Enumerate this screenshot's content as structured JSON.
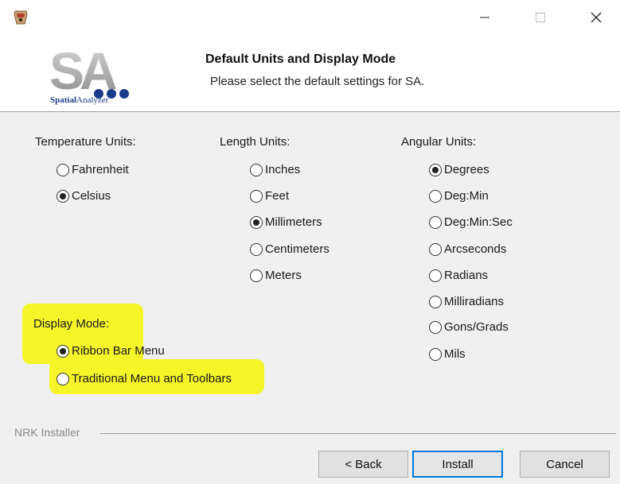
{
  "window": {
    "title": "",
    "controls": {
      "minimize": "—",
      "maximize": "□",
      "close": "✕"
    }
  },
  "header": {
    "logo_text": "SA",
    "logo_sub_bold": "Spatial",
    "logo_sub_rest": "Analyzer",
    "title": "Default Units and Display Mode",
    "subtitle": "Please select the default settings for SA."
  },
  "temperature": {
    "label": "Temperature Units:",
    "options": [
      {
        "label": "Fahrenheit",
        "checked": false
      },
      {
        "label": "Celsius",
        "checked": true
      }
    ]
  },
  "length": {
    "label": "Length Units:",
    "options": [
      {
        "label": "Inches",
        "checked": false
      },
      {
        "label": "Feet",
        "checked": false
      },
      {
        "label": "Millimeters",
        "checked": true
      },
      {
        "label": "Centimeters",
        "checked": false
      },
      {
        "label": "Meters",
        "checked": false
      }
    ]
  },
  "angular": {
    "label": "Angular Units:",
    "options": [
      {
        "label": "Degrees",
        "checked": true
      },
      {
        "label": "Deg:Min",
        "checked": false
      },
      {
        "label": "Deg:Min:Sec",
        "checked": false
      },
      {
        "label": "Arcseconds",
        "checked": false
      },
      {
        "label": "Radians",
        "checked": false
      },
      {
        "label": "Milliradians",
        "checked": false
      },
      {
        "label": "Gons/Grads",
        "checked": false
      },
      {
        "label": "Mils",
        "checked": false
      }
    ]
  },
  "display_mode": {
    "label": "Display Mode:",
    "options": [
      {
        "label": "Ribbon Bar Menu",
        "checked": true
      },
      {
        "label": "Traditional Menu and Toolbars",
        "checked": false
      }
    ]
  },
  "footer": {
    "installer_label": "NRK Installer",
    "back_label": "< Back",
    "install_label": "Install",
    "cancel_label": "Cancel"
  },
  "colors": {
    "highlight": "#f5f52a",
    "logo_blue": "#1a3a8a",
    "focus_border": "#0078d7"
  }
}
